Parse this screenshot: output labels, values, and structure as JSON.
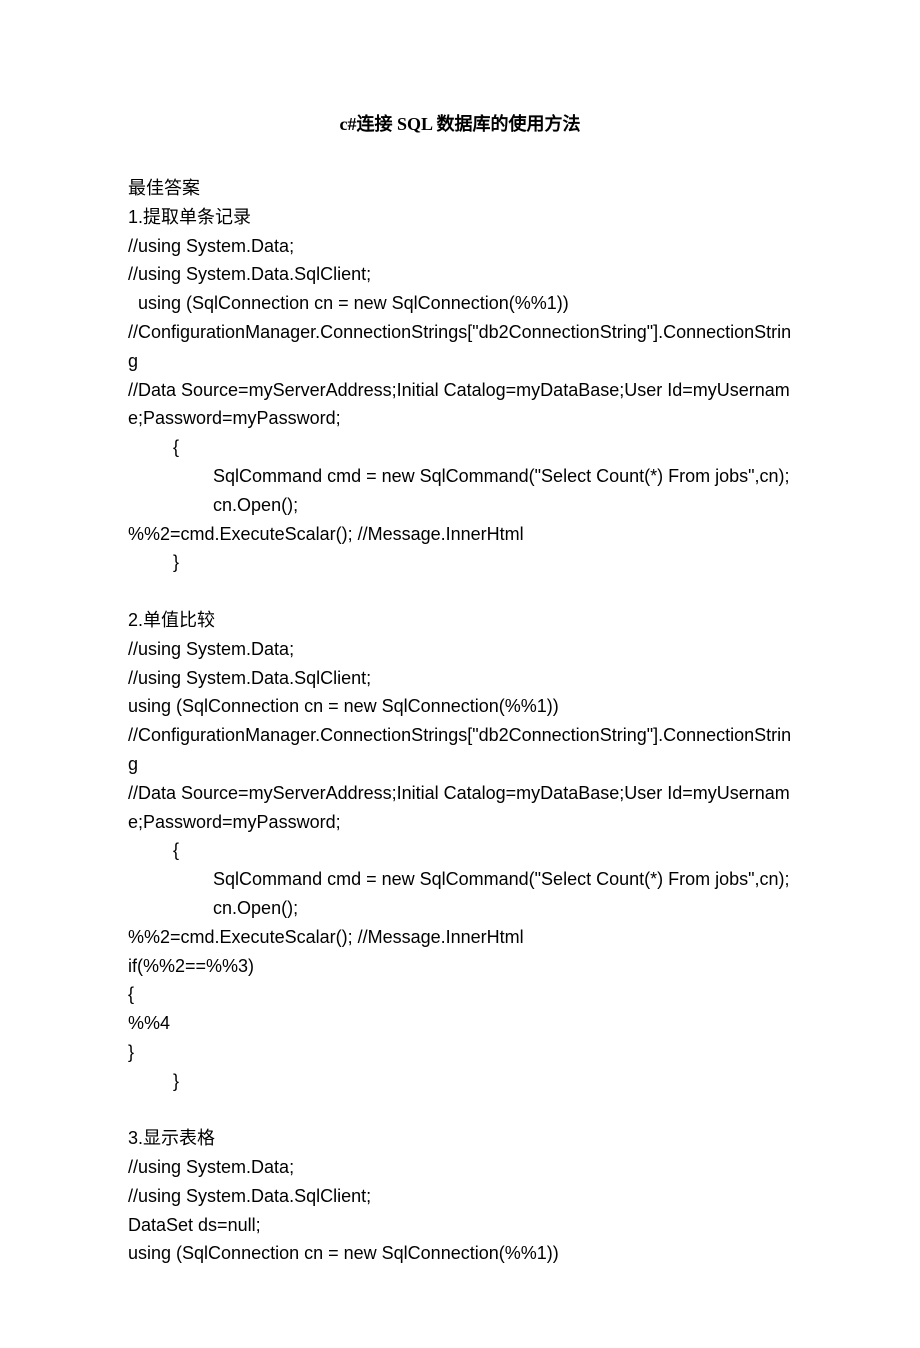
{
  "title": "c#连接 SQL 数据库的使用方法",
  "body": "最佳答案\n1.提取单条记录\n//using System.Data;\n//using System.Data.SqlClient;\n  using (SqlConnection cn = new SqlConnection(%%1))\n//ConfigurationManager.ConnectionStrings[\"db2ConnectionString\"].ConnectionString\n//Data Source=myServerAddress;Initial Catalog=myDataBase;User Id=myUsername;Password=myPassword;\n         {\n                 SqlCommand cmd = new SqlCommand(\"Select Count(*) From jobs\",cn);\n                 cn.Open();\n%%2=cmd.ExecuteScalar(); //Message.InnerHtml\n         }\n\n2.单值比较\n//using System.Data;\n//using System.Data.SqlClient;\nusing (SqlConnection cn = new SqlConnection(%%1))\n//ConfigurationManager.ConnectionStrings[\"db2ConnectionString\"].ConnectionString\n//Data Source=myServerAddress;Initial Catalog=myDataBase;User Id=myUsername;Password=myPassword;\n         {\n                 SqlCommand cmd = new SqlCommand(\"Select Count(*) From jobs\",cn);\n                 cn.Open();\n%%2=cmd.ExecuteScalar(); //Message.InnerHtml\nif(%%2==%%3)\n{\n%%4\n}\n         }\n\n3.显示表格\n//using System.Data;\n//using System.Data.SqlClient;\nDataSet ds=null;\nusing (SqlConnection cn = new SqlConnection(%%1))"
}
